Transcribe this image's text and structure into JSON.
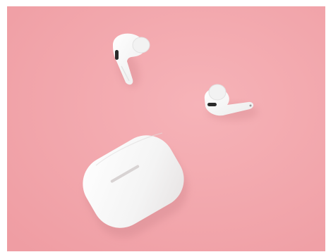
{
  "image": {
    "subject": "airpods-pro-on-pink",
    "colors": {
      "background_pink": "#f2a3a8",
      "background_pink_light": "#f6b3b8",
      "earbud_white": "#fbfbfb",
      "case_white": "#f7f7f7",
      "shadow": "#d98f95",
      "sensor_dark": "#2b2b2b"
    },
    "objects": [
      "left-earbud",
      "right-earbud",
      "charging-case"
    ]
  }
}
